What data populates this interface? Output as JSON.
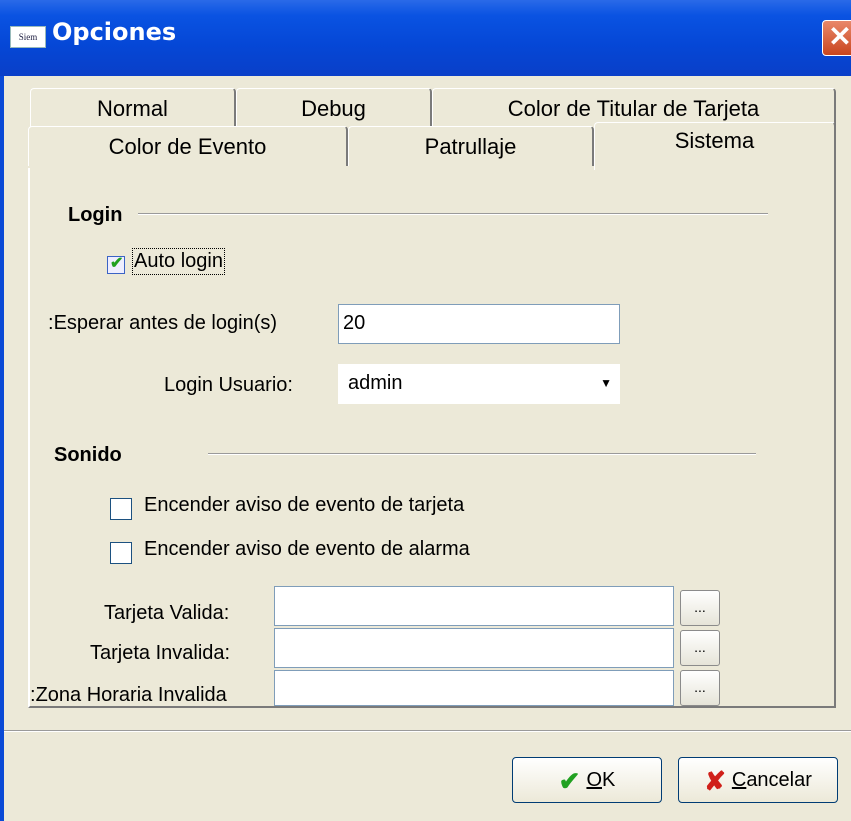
{
  "window": {
    "title": "Opciones",
    "icon_text": "Siem",
    "close_symbol": "✕"
  },
  "tabs_back": [
    "Normal",
    "Debug",
    "Color de Titular de Tarjeta"
  ],
  "tabs_front": [
    "Color de Evento",
    "Patrullaje",
    "Sistema"
  ],
  "active_tab": "Sistema",
  "login": {
    "section_title": "Login",
    "auto_login_label": "Auto login",
    "auto_login_checked": true,
    "wait_label": "Esperar antes de login(s):",
    "wait_value": "20",
    "user_label": "Login Usuario:",
    "user_value": "admin"
  },
  "sound": {
    "section_title": "Sonido",
    "card_event_label": "Encender aviso de evento de tarjeta",
    "alarm_event_label": "Encender aviso de evento de alarma",
    "valid_card_label": "Tarjeta Valida:",
    "invalid_card_label": "Tarjeta Invalida:",
    "invalid_zone_label": "Zona Horaria Invalida:",
    "browse_label": "..."
  },
  "buttons": {
    "ok_underlined": "O",
    "ok_rest": "K",
    "cancel_underlined": "C",
    "cancel_rest": "ancelar"
  },
  "colors": {
    "title_bar": "#0a53e2",
    "dialog_bg": "#ece9d8",
    "ok_icon": "#21a121",
    "cancel_icon": "#d0201a"
  },
  "icons": [
    "app-icon",
    "close-icon",
    "check-icon",
    "ok-check-icon",
    "cancel-x-icon",
    "dropdown-arrow-icon"
  ]
}
